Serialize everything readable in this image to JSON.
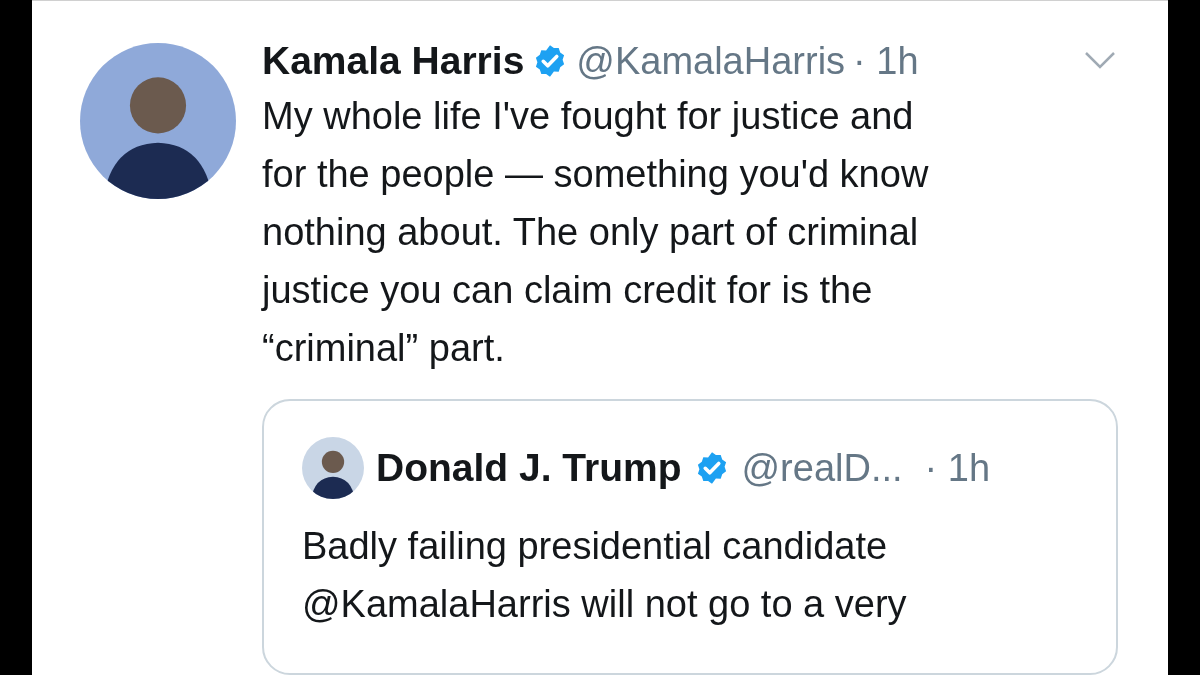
{
  "tweet": {
    "author": "Kamala Harris",
    "verified": true,
    "handle": "@KamalaHarris",
    "time": "· 1h",
    "text_lines": [
      "My whole life I've fought for justice and",
      "for the people — something you'd know",
      "nothing about. The only part of criminal",
      "justice you can claim credit for is the",
      "“criminal” part."
    ],
    "quoted": {
      "author": "Donald J. Trump",
      "verified": true,
      "handle": "@realD...",
      "time": "· 1h",
      "text_lines": [
        "Badly failing presidential candidate",
        "@KamalaHarris will not go to a very"
      ]
    }
  }
}
